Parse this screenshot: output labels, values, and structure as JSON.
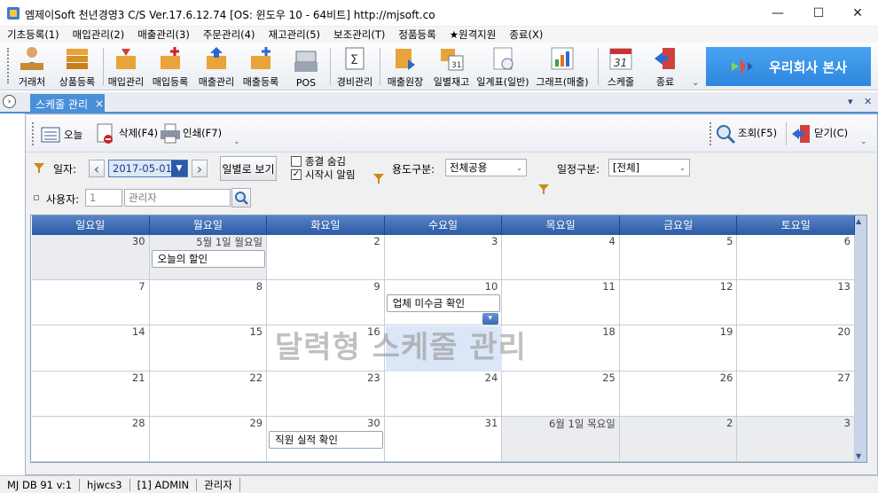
{
  "window": {
    "title": "엠제이Soft 천년경영3 C/S    Ver.17.6.12.74    [OS: 윈도우 10 - 64비트]    http://mjsoft.co",
    "minimize": "—",
    "maximize": "☐",
    "close": "✕"
  },
  "menu": [
    "기초등록(1)",
    "매입관리(2)",
    "매출관리(3)",
    "주문관리(4)",
    "재고관리(5)",
    "보조관리(T)",
    "정품등록",
    "★원격지원",
    "종료(X)"
  ],
  "toolbar": [
    {
      "label": "거래처",
      "icon": "person-icon"
    },
    {
      "label": "상품등록",
      "icon": "boxes-icon"
    },
    {
      "label": "매입관리",
      "icon": "purchase-icon"
    },
    {
      "label": "매입등록",
      "icon": "purchase-add-icon"
    },
    {
      "label": "매출관리",
      "icon": "sales-icon"
    },
    {
      "label": "매출등록",
      "icon": "sales-add-icon"
    },
    {
      "label": "POS",
      "icon": "pos-icon"
    },
    {
      "label": "경비관리",
      "icon": "expense-icon"
    },
    {
      "label": "매출원장",
      "icon": "ledger-icon"
    },
    {
      "label": "일별재고",
      "icon": "daily-stock-icon"
    },
    {
      "label": "일계표(일반)",
      "icon": "daily-report-icon"
    },
    {
      "label": "그래프(매출)",
      "icon": "graph-icon"
    },
    {
      "label": "스케줄",
      "icon": "calendar-icon"
    },
    {
      "label": "종료",
      "icon": "exit-icon"
    }
  ],
  "toolbar_more": "⌄",
  "company": "우리회사 본사",
  "doc_tab": {
    "label": "스케줄 관리",
    "close": "×"
  },
  "tabstrip_controls": {
    "dropdown": "▾",
    "close": "✕"
  },
  "inner_toolbar": {
    "today": "오늘",
    "delete": "삭제(F4)",
    "print": "인쇄(F7)",
    "search": "조회(F5)",
    "close": "닫기(C)",
    "more": "⌄"
  },
  "filters": {
    "date_label": "일자:",
    "date_value": "2017-05-01",
    "prev": "‹",
    "next": "›",
    "view_daily": "일별로 보기",
    "hide_done": "종결 숨김",
    "hide_done_checked": false,
    "alarm": "시작시 알림",
    "alarm_checked": true,
    "usage_label": "용도구분:",
    "usage_value": "전체공용",
    "schedule_label": "일정구분:",
    "schedule_value": "[전체]",
    "user_label": "사용자:",
    "user_code": "1",
    "user_name": "관리자"
  },
  "calendar": {
    "day_names": [
      "일요일",
      "월요일",
      "화요일",
      "수요일",
      "목요일",
      "금요일",
      "토요일"
    ],
    "weeks": [
      [
        {
          "d": "30",
          "gray": true
        },
        {
          "d": "5월 1일 월요일",
          "gray": true
        },
        {
          "d": "2"
        },
        {
          "d": "3"
        },
        {
          "d": "4"
        },
        {
          "d": "5"
        },
        {
          "d": "6"
        }
      ],
      [
        {
          "d": "7"
        },
        {
          "d": "8"
        },
        {
          "d": "9"
        },
        {
          "d": "10"
        },
        {
          "d": "11"
        },
        {
          "d": "12"
        },
        {
          "d": "13"
        }
      ],
      [
        {
          "d": "14"
        },
        {
          "d": "15"
        },
        {
          "d": "16"
        },
        {
          "d": "17"
        },
        {
          "d": "18"
        },
        {
          "d": "19"
        },
        {
          "d": "20"
        }
      ],
      [
        {
          "d": "21"
        },
        {
          "d": "22"
        },
        {
          "d": "23"
        },
        {
          "d": "24"
        },
        {
          "d": "25"
        },
        {
          "d": "26"
        },
        {
          "d": "27"
        }
      ],
      [
        {
          "d": "28"
        },
        {
          "d": "29"
        },
        {
          "d": "30"
        },
        {
          "d": "31"
        },
        {
          "d": "6월 1일 목요일",
          "gray": true
        },
        {
          "d": "2",
          "gray": true
        },
        {
          "d": "3",
          "gray": true
        }
      ]
    ],
    "events": {
      "sale": "오늘의 할인",
      "payable": "업체 미수금 확인",
      "performance": "직원 실적 확인"
    },
    "more_marker": "▾",
    "watermark": "달력형 스케줄 관리"
  },
  "status": [
    "MJ DB 91 v:1",
    "hjwcs3",
    "[1] ADMIN",
    "관리자"
  ]
}
